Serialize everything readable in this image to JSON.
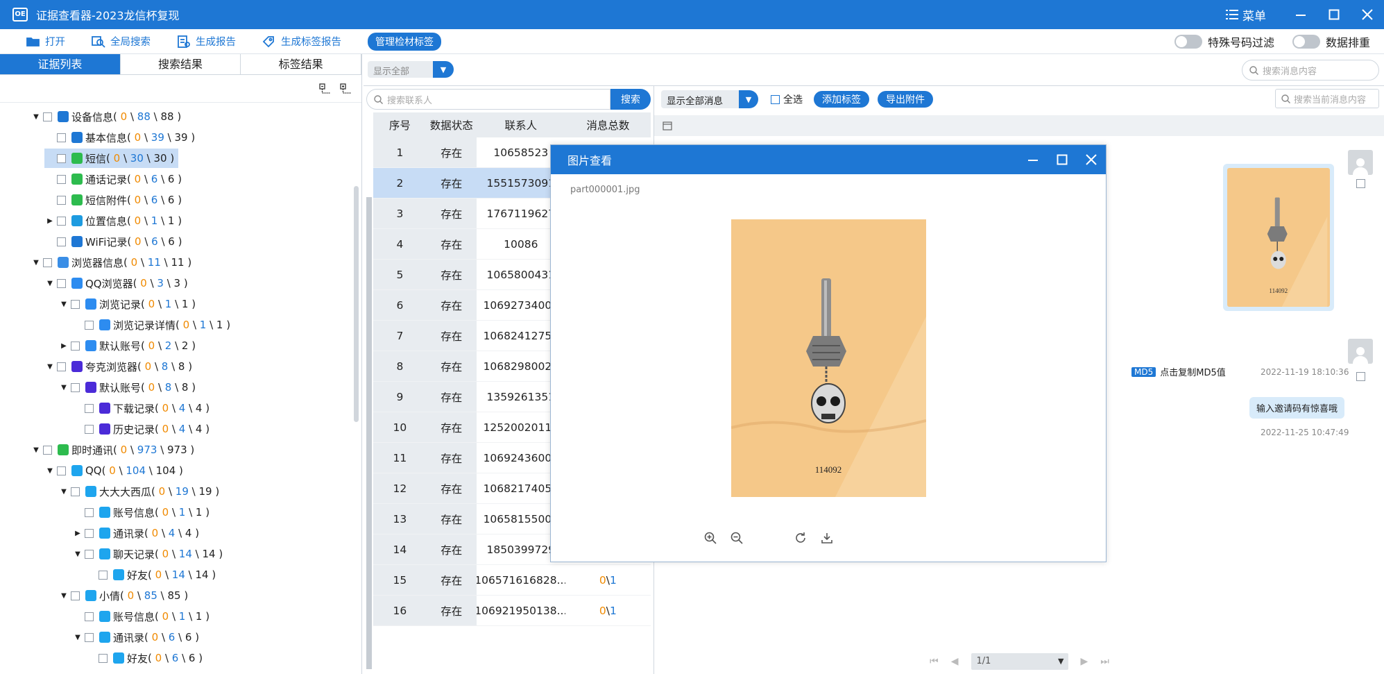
{
  "window": {
    "title": "证据查看器-2023龙信杯复现",
    "menu_label": "菜单"
  },
  "toolbar": {
    "open": "打开",
    "global_search": "全局搜索",
    "generate_report": "生成报告",
    "generate_tag_report": "生成标签报告",
    "manage_tags": "管理检材标签",
    "special_number_filter": "特殊号码过滤",
    "data_dedup": "数据排重"
  },
  "left_tabs": [
    "证据列表",
    "搜索结果",
    "标签结果"
  ],
  "tree": [
    {
      "label": "设备信息",
      "a": "0",
      "b": "88",
      "c": "88",
      "icon": "phone-icon",
      "color": "#1e77d4"
    },
    {
      "label": "基本信息",
      "a": "0",
      "b": "39",
      "c": "39",
      "icon": "phone-icon",
      "color": "#1e77d4"
    },
    {
      "label": "短信",
      "a": "0",
      "b": "30",
      "c": "30",
      "icon": "sms-icon",
      "color": "#2dbb4e"
    },
    {
      "label": "通话记录",
      "a": "0",
      "b": "6",
      "c": "6",
      "icon": "call-icon",
      "color": "#2dbb4e"
    },
    {
      "label": "短信附件",
      "a": "0",
      "b": "6",
      "c": "6",
      "icon": "sms-icon",
      "color": "#2dbb4e"
    },
    {
      "label": "位置信息",
      "a": "0",
      "b": "1",
      "c": "1",
      "icon": "location-icon",
      "color": "#1e9be0"
    },
    {
      "label": "WiFi记录",
      "a": "0",
      "b": "6",
      "c": "6",
      "icon": "wifi-icon",
      "color": "#1e77d4"
    },
    {
      "label": "浏览器信息",
      "a": "0",
      "b": "11",
      "c": "11",
      "icon": "browser-icon",
      "color": "#3a8ee6"
    },
    {
      "label": "QQ浏览器",
      "a": "0",
      "b": "3",
      "c": "3",
      "icon": "qq-browser-icon",
      "color": "#2d8cf0"
    },
    {
      "label": "浏览记录",
      "a": "0",
      "b": "1",
      "c": "1",
      "icon": "history-icon",
      "color": "#2d8cf0"
    },
    {
      "label": "浏览记录详情",
      "a": "0",
      "b": "1",
      "c": "1",
      "icon": "history-icon",
      "color": "#2d8cf0"
    },
    {
      "label": "默认账号",
      "a": "0",
      "b": "2",
      "c": "2",
      "icon": "account-icon",
      "color": "#2d8cf0"
    },
    {
      "label": "夸克浏览器",
      "a": "0",
      "b": "8",
      "c": "8",
      "icon": "quark-icon",
      "color": "#4b2bd8"
    },
    {
      "label": "默认账号",
      "a": "0",
      "b": "8",
      "c": "8",
      "icon": "quark-icon",
      "color": "#4b2bd8"
    },
    {
      "label": "下载记录",
      "a": "0",
      "b": "4",
      "c": "4",
      "icon": "download-icon",
      "color": "#4b2bd8"
    },
    {
      "label": "历史记录",
      "a": "0",
      "b": "4",
      "c": "4",
      "icon": "history-icon",
      "color": "#4b2bd8"
    },
    {
      "label": "即时通讯",
      "a": "0",
      "b": "973",
      "c": "973",
      "icon": "im-icon",
      "color": "#2dbb4e"
    },
    {
      "label": "QQ",
      "a": "0",
      "b": "104",
      "c": "104",
      "icon": "qq-icon",
      "color": "#1ea5ee"
    },
    {
      "label": "大大大西瓜",
      "a": "0",
      "b": "19",
      "c": "19",
      "icon": "qq-user-icon",
      "color": "#1ea5ee"
    },
    {
      "label": "账号信息",
      "a": "0",
      "b": "1",
      "c": "1",
      "icon": "qq-user-icon",
      "color": "#1ea5ee"
    },
    {
      "label": "通讯录",
      "a": "0",
      "b": "4",
      "c": "4",
      "icon": "contacts-icon",
      "color": "#1ea5ee"
    },
    {
      "label": "聊天记录",
      "a": "0",
      "b": "14",
      "c": "14",
      "icon": "chat-icon",
      "color": "#1ea5ee"
    },
    {
      "label": "好友",
      "a": "0",
      "b": "14",
      "c": "14",
      "icon": "friend-icon",
      "color": "#1ea5ee"
    },
    {
      "label": "小倩",
      "a": "0",
      "b": "85",
      "c": "85",
      "icon": "qq-user-icon",
      "color": "#1ea5ee"
    },
    {
      "label": "账号信息",
      "a": "0",
      "b": "1",
      "c": "1",
      "icon": "qq-user-icon",
      "color": "#1ea5ee"
    },
    {
      "label": "通讯录",
      "a": "0",
      "b": "6",
      "c": "6",
      "icon": "contacts-icon",
      "color": "#1ea5ee"
    },
    {
      "label": "好友",
      "a": "0",
      "b": "6",
      "c": "6",
      "icon": "friend-icon",
      "color": "#1ea5ee"
    }
  ],
  "filters": {
    "show_all": "显示全部",
    "message_search_placeholder": "搜索消息内容",
    "contact_search_placeholder": "搜索联系人",
    "search_button": "搜索"
  },
  "table": {
    "headers": [
      "序号",
      "数据状态",
      "联系人",
      "消息总数"
    ],
    "rows": [
      {
        "no": "1",
        "status": "存在",
        "contact": "10658523",
        "count": ""
      },
      {
        "no": "2",
        "status": "存在",
        "contact": "1551573091",
        "count": ""
      },
      {
        "no": "3",
        "status": "存在",
        "contact": "1767119627",
        "count": ""
      },
      {
        "no": "4",
        "status": "存在",
        "contact": "10086",
        "count": ""
      },
      {
        "no": "5",
        "status": "存在",
        "contact": "1065800431",
        "count": ""
      },
      {
        "no": "6",
        "status": "存在",
        "contact": "10692734004",
        "count": ""
      },
      {
        "no": "7",
        "status": "存在",
        "contact": "10682412752",
        "count": ""
      },
      {
        "no": "8",
        "status": "存在",
        "contact": "10682980021",
        "count": ""
      },
      {
        "no": "9",
        "status": "存在",
        "contact": "1359261351",
        "count": ""
      },
      {
        "no": "10",
        "status": "存在",
        "contact": "12520020118",
        "count": ""
      },
      {
        "no": "11",
        "status": "存在",
        "contact": "10692436000",
        "count": ""
      },
      {
        "no": "12",
        "status": "存在",
        "contact": "10682174050",
        "count": ""
      },
      {
        "no": "13",
        "status": "存在",
        "contact": "10658155000",
        "count": ""
      },
      {
        "no": "14",
        "status": "存在",
        "contact": "1850399729",
        "count": ""
      },
      {
        "no": "15",
        "status": "存在",
        "contact": "106571616828...",
        "count": "1"
      },
      {
        "no": "16",
        "status": "存在",
        "contact": "106921950138...",
        "count": "1"
      }
    ]
  },
  "conversation": {
    "filter": "显示全部消息",
    "select_all": "全选",
    "add_tag": "添加标签",
    "export_attachment": "导出附件",
    "search_placeholder": "搜索当前消息内容",
    "md5_tag": "MD5",
    "md5_text": "点击复制MD5值",
    "time1": "2022-11-19 18:10:36",
    "bubble_text": "输入邀请码有惊喜哦",
    "time2": "2022-11-25 10:47:49",
    "page": "1/1",
    "thumb_caption": "114092"
  },
  "viewer": {
    "title": "图片查看",
    "filename": "part000001.jpg",
    "caption": "114092"
  }
}
